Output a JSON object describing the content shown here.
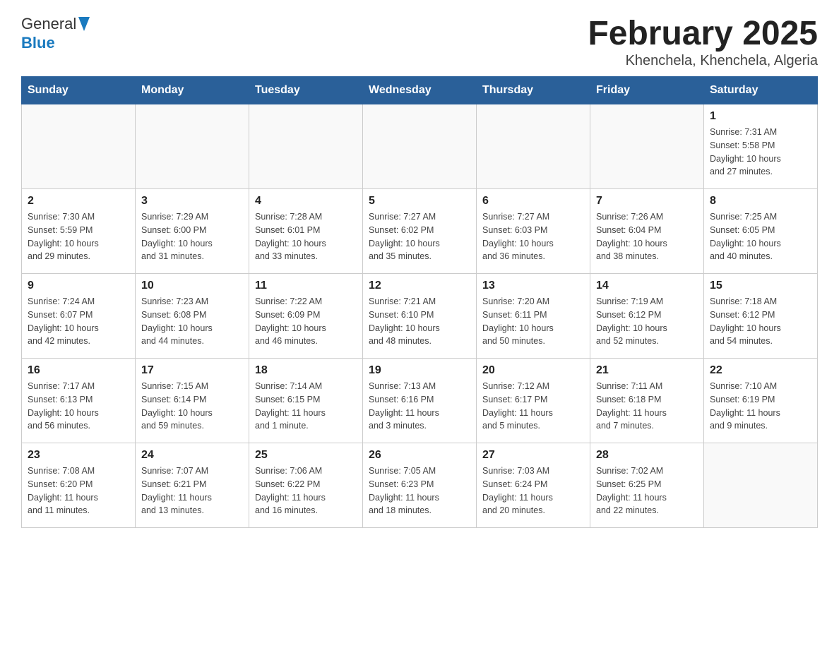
{
  "logo": {
    "text_general": "General",
    "text_blue": "Blue",
    "arrow": "▶"
  },
  "title": "February 2025",
  "subtitle": "Khenchela, Khenchela, Algeria",
  "days_of_week": [
    "Sunday",
    "Monday",
    "Tuesday",
    "Wednesday",
    "Thursday",
    "Friday",
    "Saturday"
  ],
  "weeks": [
    [
      {
        "day": "",
        "info": ""
      },
      {
        "day": "",
        "info": ""
      },
      {
        "day": "",
        "info": ""
      },
      {
        "day": "",
        "info": ""
      },
      {
        "day": "",
        "info": ""
      },
      {
        "day": "",
        "info": ""
      },
      {
        "day": "1",
        "info": "Sunrise: 7:31 AM\nSunset: 5:58 PM\nDaylight: 10 hours\nand 27 minutes."
      }
    ],
    [
      {
        "day": "2",
        "info": "Sunrise: 7:30 AM\nSunset: 5:59 PM\nDaylight: 10 hours\nand 29 minutes."
      },
      {
        "day": "3",
        "info": "Sunrise: 7:29 AM\nSunset: 6:00 PM\nDaylight: 10 hours\nand 31 minutes."
      },
      {
        "day": "4",
        "info": "Sunrise: 7:28 AM\nSunset: 6:01 PM\nDaylight: 10 hours\nand 33 minutes."
      },
      {
        "day": "5",
        "info": "Sunrise: 7:27 AM\nSunset: 6:02 PM\nDaylight: 10 hours\nand 35 minutes."
      },
      {
        "day": "6",
        "info": "Sunrise: 7:27 AM\nSunset: 6:03 PM\nDaylight: 10 hours\nand 36 minutes."
      },
      {
        "day": "7",
        "info": "Sunrise: 7:26 AM\nSunset: 6:04 PM\nDaylight: 10 hours\nand 38 minutes."
      },
      {
        "day": "8",
        "info": "Sunrise: 7:25 AM\nSunset: 6:05 PM\nDaylight: 10 hours\nand 40 minutes."
      }
    ],
    [
      {
        "day": "9",
        "info": "Sunrise: 7:24 AM\nSunset: 6:07 PM\nDaylight: 10 hours\nand 42 minutes."
      },
      {
        "day": "10",
        "info": "Sunrise: 7:23 AM\nSunset: 6:08 PM\nDaylight: 10 hours\nand 44 minutes."
      },
      {
        "day": "11",
        "info": "Sunrise: 7:22 AM\nSunset: 6:09 PM\nDaylight: 10 hours\nand 46 minutes."
      },
      {
        "day": "12",
        "info": "Sunrise: 7:21 AM\nSunset: 6:10 PM\nDaylight: 10 hours\nand 48 minutes."
      },
      {
        "day": "13",
        "info": "Sunrise: 7:20 AM\nSunset: 6:11 PM\nDaylight: 10 hours\nand 50 minutes."
      },
      {
        "day": "14",
        "info": "Sunrise: 7:19 AM\nSunset: 6:12 PM\nDaylight: 10 hours\nand 52 minutes."
      },
      {
        "day": "15",
        "info": "Sunrise: 7:18 AM\nSunset: 6:12 PM\nDaylight: 10 hours\nand 54 minutes."
      }
    ],
    [
      {
        "day": "16",
        "info": "Sunrise: 7:17 AM\nSunset: 6:13 PM\nDaylight: 10 hours\nand 56 minutes."
      },
      {
        "day": "17",
        "info": "Sunrise: 7:15 AM\nSunset: 6:14 PM\nDaylight: 10 hours\nand 59 minutes."
      },
      {
        "day": "18",
        "info": "Sunrise: 7:14 AM\nSunset: 6:15 PM\nDaylight: 11 hours\nand 1 minute."
      },
      {
        "day": "19",
        "info": "Sunrise: 7:13 AM\nSunset: 6:16 PM\nDaylight: 11 hours\nand 3 minutes."
      },
      {
        "day": "20",
        "info": "Sunrise: 7:12 AM\nSunset: 6:17 PM\nDaylight: 11 hours\nand 5 minutes."
      },
      {
        "day": "21",
        "info": "Sunrise: 7:11 AM\nSunset: 6:18 PM\nDaylight: 11 hours\nand 7 minutes."
      },
      {
        "day": "22",
        "info": "Sunrise: 7:10 AM\nSunset: 6:19 PM\nDaylight: 11 hours\nand 9 minutes."
      }
    ],
    [
      {
        "day": "23",
        "info": "Sunrise: 7:08 AM\nSunset: 6:20 PM\nDaylight: 11 hours\nand 11 minutes."
      },
      {
        "day": "24",
        "info": "Sunrise: 7:07 AM\nSunset: 6:21 PM\nDaylight: 11 hours\nand 13 minutes."
      },
      {
        "day": "25",
        "info": "Sunrise: 7:06 AM\nSunset: 6:22 PM\nDaylight: 11 hours\nand 16 minutes."
      },
      {
        "day": "26",
        "info": "Sunrise: 7:05 AM\nSunset: 6:23 PM\nDaylight: 11 hours\nand 18 minutes."
      },
      {
        "day": "27",
        "info": "Sunrise: 7:03 AM\nSunset: 6:24 PM\nDaylight: 11 hours\nand 20 minutes."
      },
      {
        "day": "28",
        "info": "Sunrise: 7:02 AM\nSunset: 6:25 PM\nDaylight: 11 hours\nand 22 minutes."
      },
      {
        "day": "",
        "info": ""
      }
    ]
  ]
}
